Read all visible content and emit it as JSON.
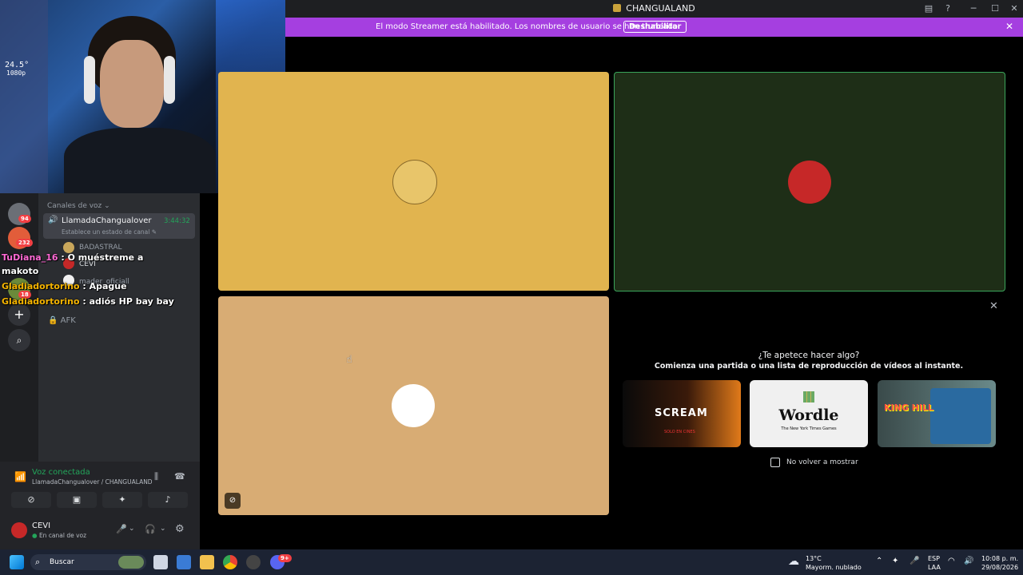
{
  "window": {
    "title": "CHANGUALAND"
  },
  "title_icons": {
    "inbox": "inbox-icon",
    "help": "?",
    "minimize": "─",
    "maximize": "☐",
    "close": "✕"
  },
  "banner": {
    "message": "El modo Streamer está habilitado. Los nombres de usuario se han truncado.",
    "button": "Deshabilitar",
    "close": "✕"
  },
  "servers": [
    {
      "badge": "94",
      "color": "#6b6f76"
    },
    {
      "badge": "232",
      "color": "#e25d3a"
    },
    {
      "badge": "18",
      "color": "#6b8a3a"
    }
  ],
  "server_add": "+",
  "server_explore": "⌕",
  "channels": {
    "header": "Canales de voz",
    "active_channel": {
      "name": "LlamadaChangualover",
      "timer": "3:44:32",
      "status": "Establece un estado de canal"
    },
    "users": [
      {
        "name": "BADASTRAL"
      },
      {
        "name": "CEVI"
      },
      {
        "name": "mader_oficiall"
      }
    ],
    "afk": "AFK"
  },
  "overlay_chat": [
    {
      "user": "TuDiana_16",
      "text": ": O muéstreme a",
      "color": "#ff6ad5"
    },
    {
      "user": "",
      "text": "makoto",
      "color": "#ffffff"
    },
    {
      "user": "Gladiadortorino",
      "text": ": Apague",
      "color": "#f5b400"
    },
    {
      "user": "Gladiadortorino",
      "text": ": adiós HP bay bay",
      "color": "#f5b400"
    }
  ],
  "webcam": {
    "overlay_top": "24.5°",
    "overlay_sub": "1080p"
  },
  "voice_panel": {
    "status": "Voz conectada",
    "location": "LlamadaChangualover / CHANGUALAND",
    "username": "CEVI",
    "user_status": "En canal de voz"
  },
  "tiles": [
    {
      "bg": "#e1b44f",
      "avatar_color": "#e8c56a"
    },
    {
      "bg": "#1e2e17",
      "avatar_color": "#c62828"
    },
    {
      "bg": "#d8ac74",
      "avatar_color": "#ffffff"
    }
  ],
  "activity": {
    "title": "¿Te apetece hacer algo?",
    "subtitle": "Comienza una partida o una lista de reproducción de vídeos al instante.",
    "cards": [
      {
        "label": "SCREAM",
        "sub": "SOLO EN CINES"
      },
      {
        "label": "Wordle",
        "sub": "The New York Times Games"
      },
      {
        "label": "KING HILL",
        "sub": ""
      }
    ],
    "checkbox": "No volver a mostrar"
  },
  "taskbar": {
    "search": "Buscar",
    "weather_temp": "13°C",
    "weather_desc": "Mayorm. nublado",
    "lang": "ESP",
    "lang2": "LAA",
    "time": "10:08 p. m.",
    "date": "29/08/2026",
    "notif_badge": "9+"
  }
}
